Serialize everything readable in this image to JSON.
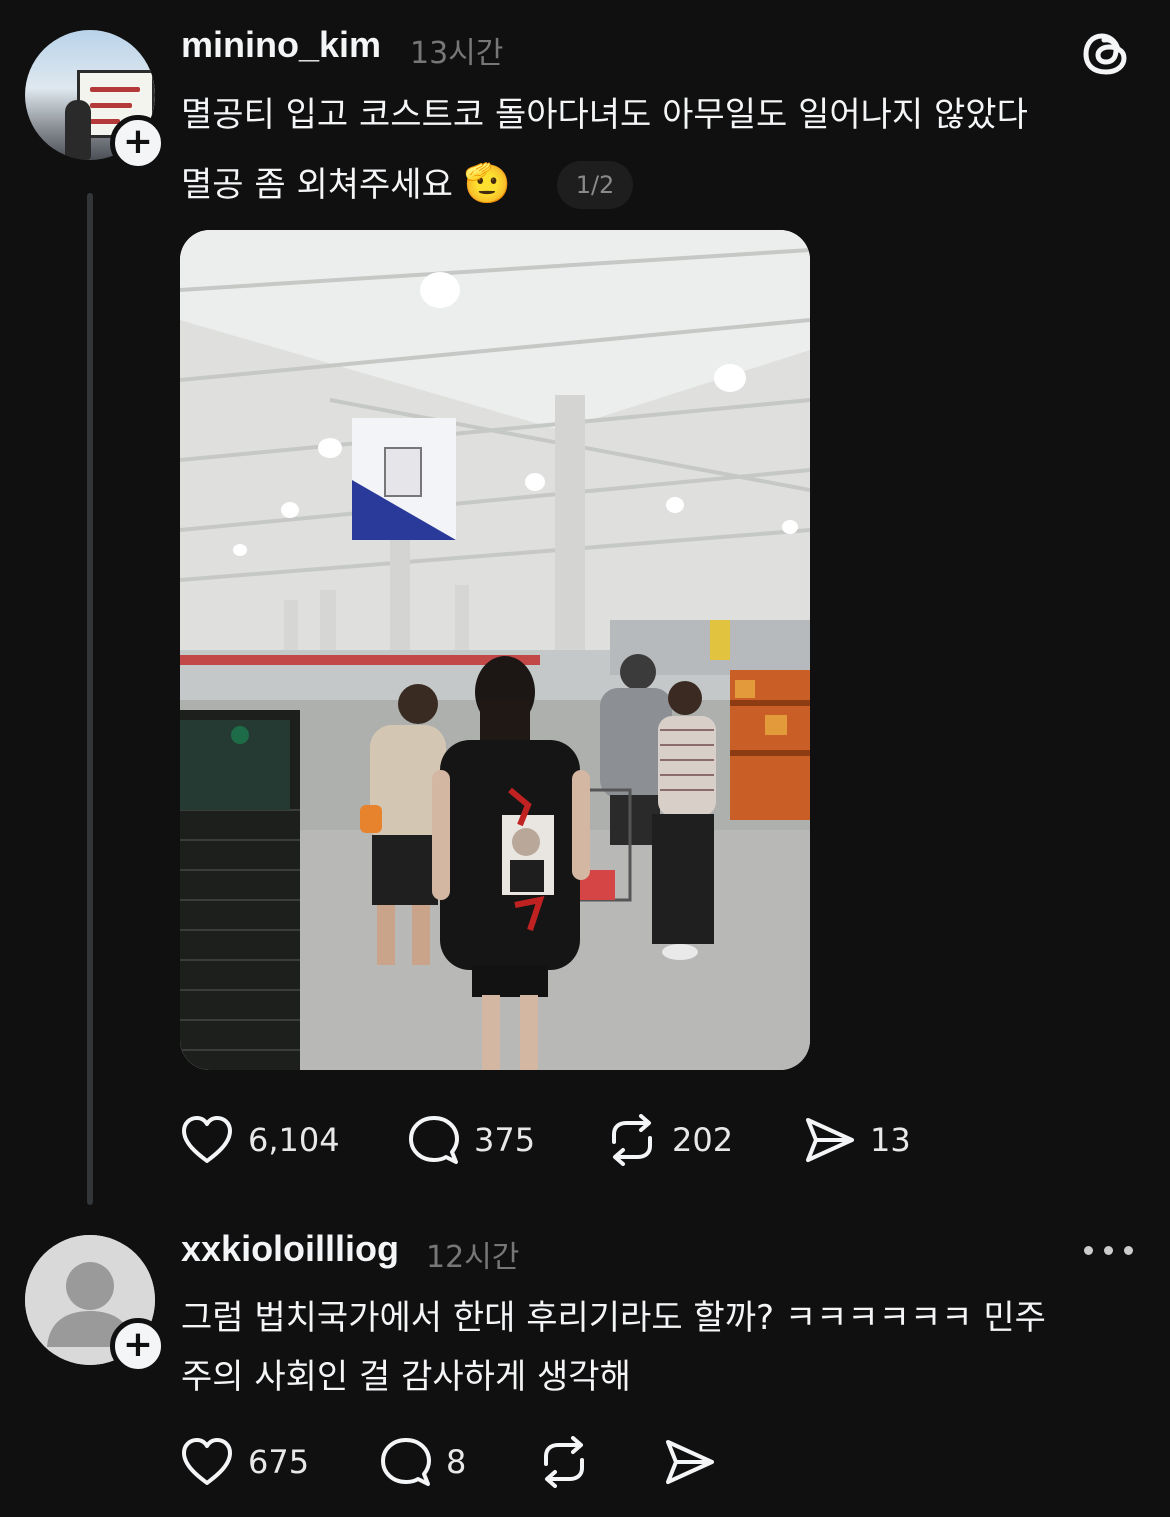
{
  "post": {
    "username": "minino_kim",
    "time": "13시간",
    "text_line1": "멸공티 입고 코스트코 돌아다녀도 아무일도 일어나지 않았다",
    "text_line2": "멸공 좀 외쳐주세요",
    "emoji": "🫡",
    "page_indicator": "1/2",
    "image_desc_icon": "photo-costco-store",
    "stats": {
      "likes": "6,104",
      "replies": "375",
      "reposts": "202",
      "shares": "13"
    }
  },
  "reply": {
    "username": "xxkioloillliog",
    "time": "12시간",
    "text_line1": "그럼 법치국가에서 한대 후리기라도 할까? ㅋㅋㅋㅋㅋㅋ 민주",
    "text_line2": "주의 사회인 걸 감사하게 생각해",
    "stats": {
      "likes": "675",
      "replies": "8"
    }
  },
  "colors": {
    "background": "#101010",
    "text": "#f3f5f7",
    "secondary": "#777777"
  }
}
